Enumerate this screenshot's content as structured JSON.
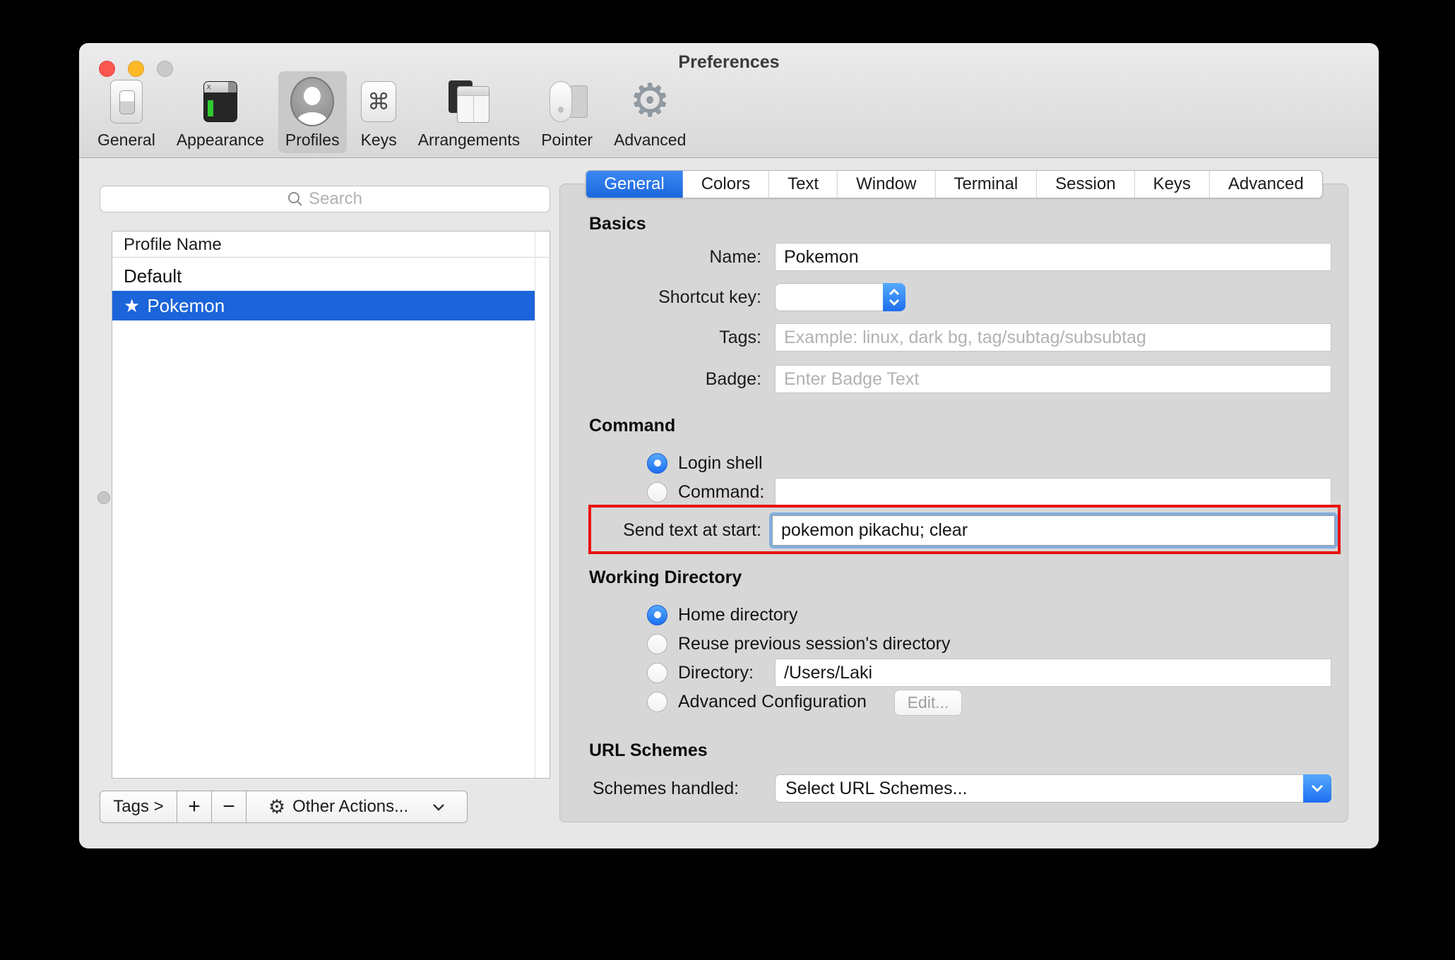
{
  "window": {
    "title": "Preferences"
  },
  "toolbar": {
    "selected": "Profiles",
    "items": [
      {
        "label": "General",
        "icon": "general-icon"
      },
      {
        "label": "Appearance",
        "icon": "appearance-icon"
      },
      {
        "label": "Profiles",
        "icon": "profiles-icon"
      },
      {
        "label": "Keys",
        "icon": "keys-icon"
      },
      {
        "label": "Arrangements",
        "icon": "arrangements-icon"
      },
      {
        "label": "Pointer",
        "icon": "pointer-icon"
      },
      {
        "label": "Advanced",
        "icon": "advanced-gear-icon"
      }
    ],
    "keys_glyph": "⌘",
    "advanced_glyph": "⚙"
  },
  "tabs": {
    "selected": "General",
    "items": [
      "General",
      "Colors",
      "Text",
      "Window",
      "Terminal",
      "Session",
      "Keys",
      "Advanced"
    ]
  },
  "sidebar": {
    "search_placeholder": "Search",
    "list_header": "Profile Name",
    "profiles": [
      {
        "name": "Default",
        "starred": false,
        "selected": false
      },
      {
        "name": "Pokemon",
        "starred": true,
        "star": "★",
        "selected": true
      }
    ],
    "footer": {
      "tags_label": "Tags >",
      "add_label": "+",
      "remove_label": "−",
      "other_actions_gear": "⚙",
      "other_actions_label": "Other Actions..."
    }
  },
  "panel": {
    "basics": {
      "heading": "Basics",
      "name_label": "Name:",
      "name_value": "Pokemon",
      "shortcut_label": "Shortcut key:",
      "shortcut_value": "",
      "tags_label": "Tags:",
      "tags_placeholder": "Example: linux, dark bg, tag/subtag/subsubtag",
      "badge_label": "Badge:",
      "badge_placeholder": "Enter Badge Text"
    },
    "command": {
      "heading": "Command",
      "selected_option": "Login shell",
      "login_shell_label": "Login shell",
      "command_label": "Command:",
      "command_value": "",
      "send_text_label": "Send text at start:",
      "send_text_value": "pokemon pikachu; clear"
    },
    "working_directory": {
      "heading": "Working Directory",
      "selected_option": "Home directory",
      "home_label": "Home directory",
      "reuse_label": "Reuse previous session's directory",
      "directory_label": "Directory:",
      "directory_value": "/Users/Laki",
      "advanced_label": "Advanced Configuration",
      "edit_button_label": "Edit..."
    },
    "url_schemes": {
      "heading": "URL Schemes",
      "schemes_label": "Schemes handled:",
      "schemes_value": "Select URL Schemes..."
    }
  },
  "colors": {
    "selection_blue": "#1b64d9",
    "tab_blue": "#2372e6",
    "radio_blue": "#1d6ff1",
    "radio_blue_light": "#55a9fc",
    "focus_ring": "#82aede",
    "annotation_red": "#e8130c",
    "placeholder_gray": "#b2b2b2"
  }
}
